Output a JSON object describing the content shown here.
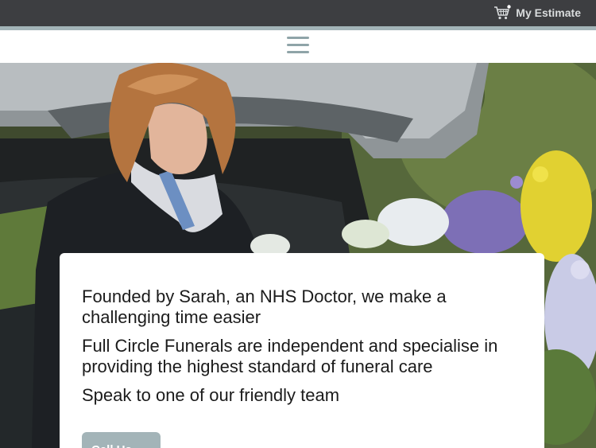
{
  "header": {
    "estimate_label": "My Estimate",
    "cart_icon": "shopping-cart-icon",
    "menu_icon": "hamburger-menu-icon"
  },
  "hero": {
    "paragraphs": [
      "Founded by Sarah, an NHS Doctor, we make a challenging time easier",
      "Full Circle Funerals are independent and specialise in providing the highest standard of funeral care",
      "Speak to one of our friendly team"
    ],
    "cta_label": "Call Us"
  },
  "colors": {
    "topbar": "#3d3e41",
    "accent": "#a3b4b8",
    "text": "#1b1b1b"
  }
}
